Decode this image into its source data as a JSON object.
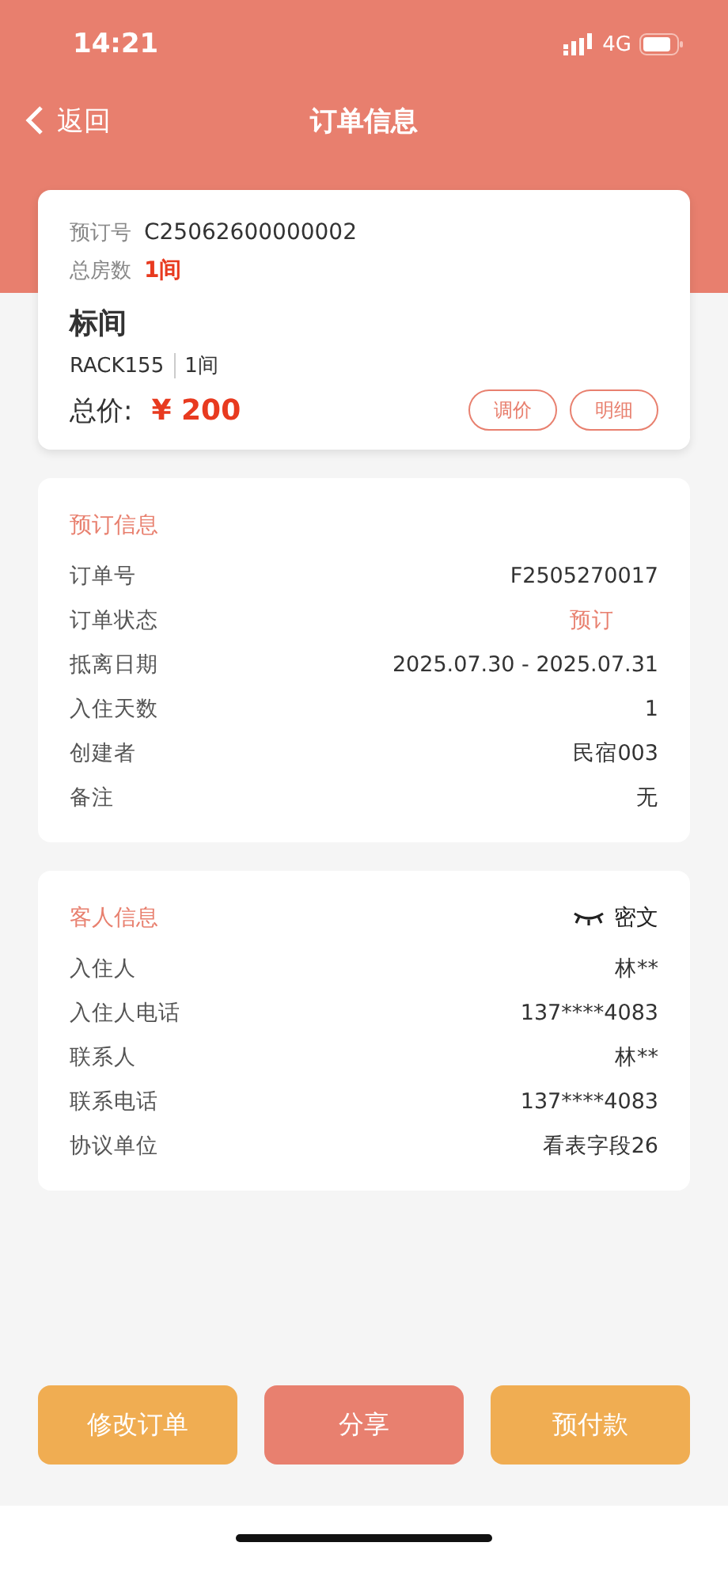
{
  "status_bar": {
    "time": "14:21",
    "network": "4G"
  },
  "nav": {
    "back": "返回",
    "title": "订单信息"
  },
  "summary": {
    "booking_label": "预订号",
    "booking_no": "C25062600000002",
    "rooms_label": "总房数",
    "rooms": "1间",
    "room_type": "标间",
    "rate_code": "RACK155",
    "room_count": "1间",
    "total_label": "总价:",
    "total": "¥ 200",
    "actions": [
      "调价",
      "明细"
    ]
  },
  "booking_info": {
    "title": "预订信息",
    "rows": [
      {
        "label": "订单号",
        "value": "F2505270017",
        "kind": "plain"
      },
      {
        "label": "订单状态",
        "value": "预订",
        "kind": "status"
      },
      {
        "label": "抵离日期",
        "value": "2025.07.30 - 2025.07.31",
        "kind": "plain"
      },
      {
        "label": "入住天数",
        "value": "1",
        "kind": "plain"
      },
      {
        "label": "创建者",
        "value": "民宿003",
        "kind": "plain"
      },
      {
        "label": "备注",
        "value": "无",
        "kind": "plain"
      }
    ]
  },
  "guest_info": {
    "title": "客人信息",
    "toggle": "密文",
    "rows": [
      {
        "label": "入住人",
        "value": "林**"
      },
      {
        "label": "入住人电话",
        "value": "137****4083"
      },
      {
        "label": "联系人",
        "value": "林**"
      },
      {
        "label": "联系电话",
        "value": "137****4083"
      },
      {
        "label": "协议单位",
        "value": "看表字段26"
      }
    ]
  },
  "buttons": [
    {
      "label": "修改订单",
      "kind": "secondary"
    },
    {
      "label": "分享",
      "kind": "primary"
    },
    {
      "label": "预付款",
      "kind": "secondary"
    }
  ]
}
